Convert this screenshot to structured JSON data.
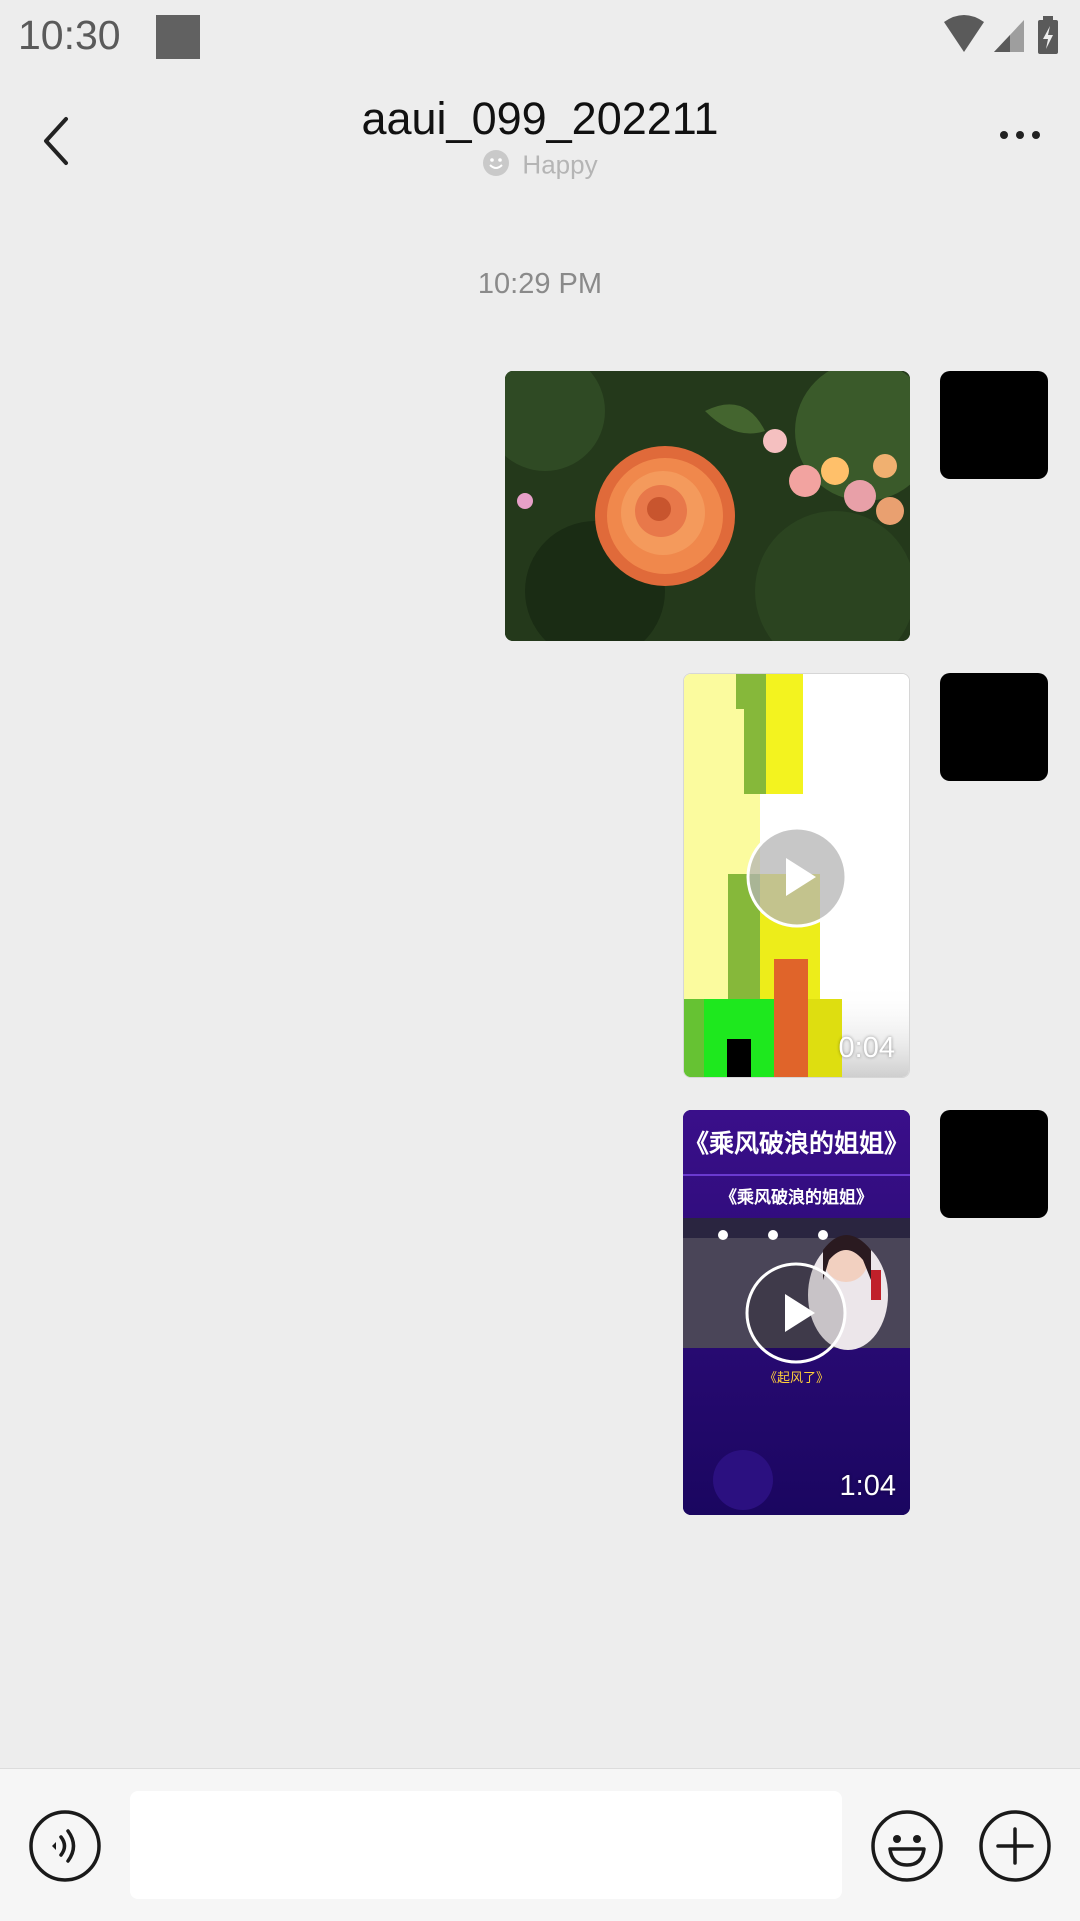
{
  "status_bar": {
    "time": "10:30",
    "icons": [
      "wifi-icon",
      "cell-signal-icon",
      "battery-charging-icon"
    ]
  },
  "header": {
    "title": "aaui_099_202211",
    "status_text": "Happy",
    "back_icon": "chevron-left-icon",
    "more_icon": "more-dots-icon"
  },
  "chat": {
    "timestamp": "10:29 PM",
    "messages": [
      {
        "type": "image",
        "description": "rose-photo"
      },
      {
        "type": "video",
        "duration": "0:04"
      },
      {
        "type": "video",
        "duration": "1:04",
        "overlay_title": "《乘风破浪的姐姐》",
        "overlay_subtitle": "《乘风破浪的姐姐》",
        "overlay_song": "《起风了》"
      }
    ]
  },
  "input_bar": {
    "placeholder": "",
    "icons": [
      "voice-icon",
      "emoji-icon",
      "plus-icon"
    ]
  },
  "colors": {
    "background": "#ededed",
    "avatar": "#000000",
    "bottom_bar": "#f6f6f6"
  }
}
